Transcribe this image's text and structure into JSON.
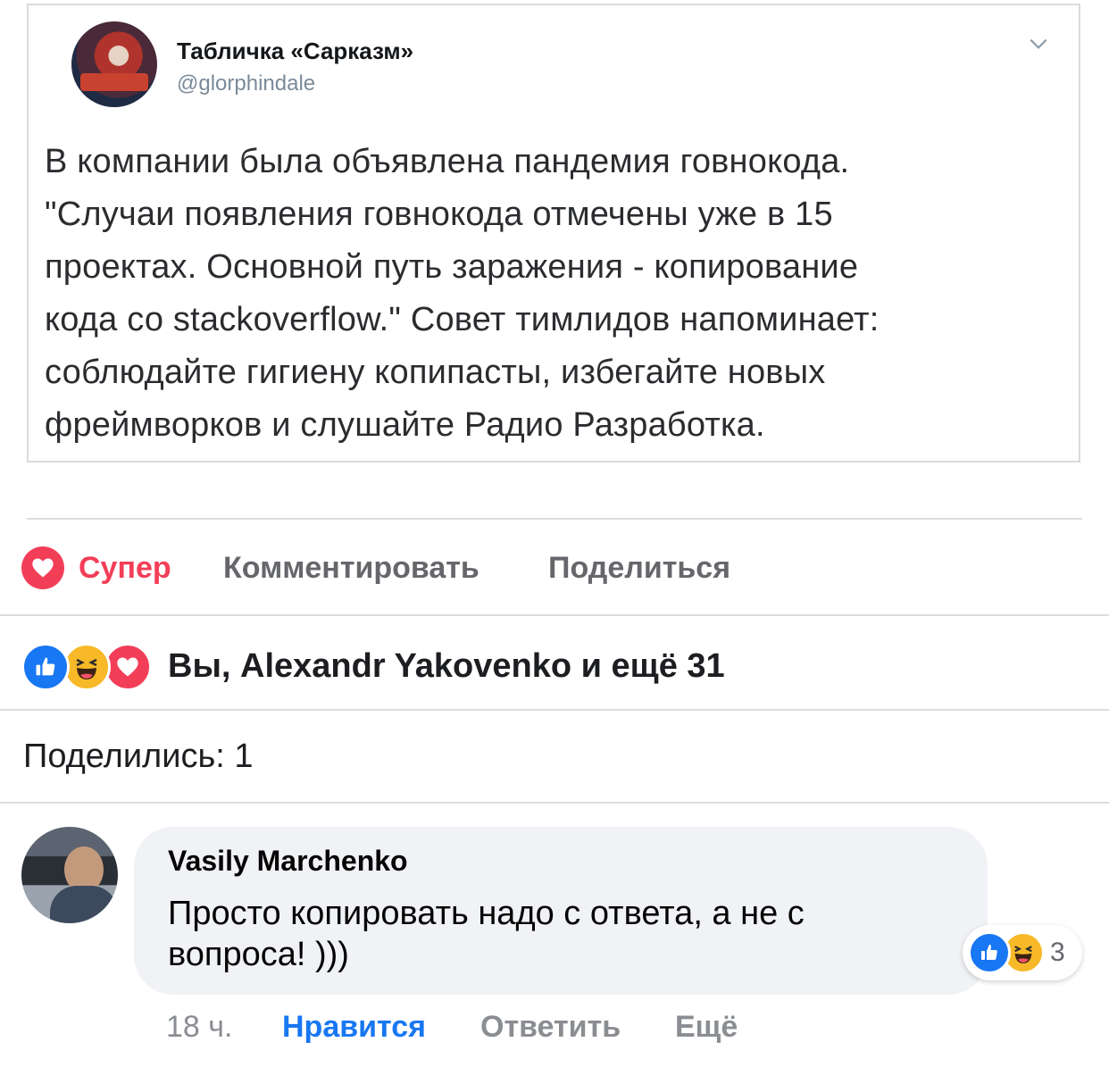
{
  "tweet": {
    "author_name": "Табличка «Сарказм»",
    "handle": "@glorphindale",
    "lines": [
      "В компании была объявлена пандемия говнокода.",
      "\"Случаи появления говнокода отмечены уже в 15",
      "проектах. Основной путь заражения - копирование",
      "кода со stackoverflow.\" Совет тимлидов напоминает:",
      "соблюдайте гигиену копипасты, избегайте новых",
      "фреймворков и слушайте Радио Разработка."
    ]
  },
  "actions": {
    "super_label": "Супер",
    "comment_label": "Комментировать",
    "share_label": "Поделиться"
  },
  "reactions_summary": {
    "text": "Вы, Alexandr Yakovenko и ещё 31",
    "icons": [
      "like-icon",
      "haha-icon",
      "love-icon"
    ]
  },
  "shares": {
    "text": "Поделились: 1"
  },
  "comment": {
    "author": "Vasily Marchenko",
    "text": "Просто копировать надо с ответа, а не с вопроса! )))",
    "reaction_count": "3",
    "time": "18 ч.",
    "like_label": "Нравится",
    "reply_label": "Ответить",
    "more_label": "Ещё"
  },
  "colors": {
    "accent_blue": "#1877f2",
    "love_red": "#f33e58",
    "haha_yellow": "#f7b928",
    "muted_text": "#65676b"
  }
}
